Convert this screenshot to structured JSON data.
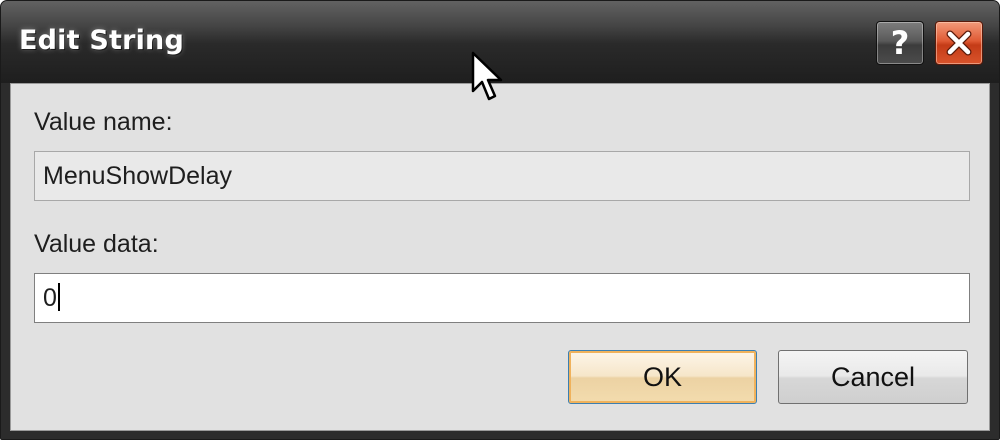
{
  "window": {
    "title": "Edit String",
    "help_label": "?",
    "close_icon": "close-x-icon"
  },
  "form": {
    "value_name_label": "Value name:",
    "value_name": "MenuShowDelay",
    "value_data_label": "Value data:",
    "value_data": "0"
  },
  "buttons": {
    "ok_label": "OK",
    "cancel_label": "Cancel"
  },
  "colors": {
    "titlebar": "#2a2a2a",
    "client_bg": "#e1e1e1",
    "close_button": "#d9542c",
    "default_button_glow": "#f0b25c"
  }
}
